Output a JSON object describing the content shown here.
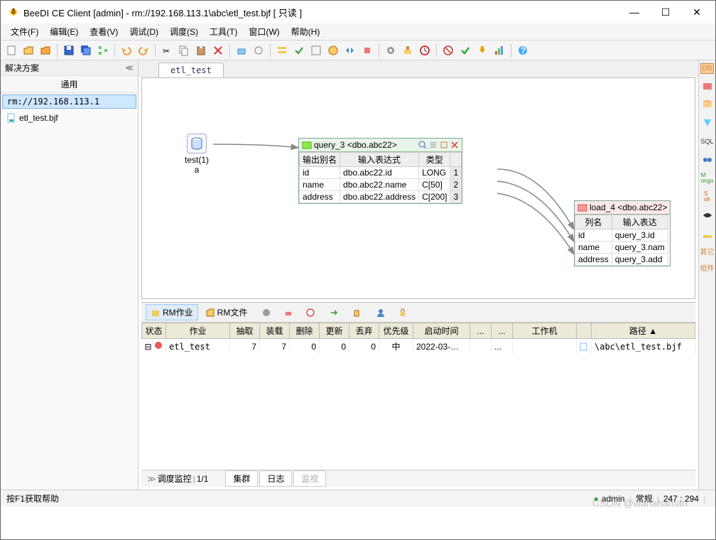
{
  "window": {
    "title": "BeeDI CE Client [admin] - rm://192.168.113.1\\abc\\etl_test.bjf [ 只读 ]"
  },
  "menu": {
    "file": "文件(F)",
    "edit": "编辑(E)",
    "view": "查看(V)",
    "debug": "调试(D)",
    "schedule": "调度(S)",
    "tools": "工具(T)",
    "window": "窗口(W)",
    "help": "帮助(H)"
  },
  "sidebar": {
    "title": "解决方案",
    "sub": "通用",
    "server": "rm://192.168.113.1",
    "file": "etl_test.bjf"
  },
  "tab": {
    "label": "etl_test"
  },
  "canvas": {
    "node1": {
      "label1": "test(1)",
      "label2": "a"
    },
    "query": {
      "title": "query_3 <dbo.abc22>",
      "cols": [
        "输出别名",
        "输入表达式",
        "类型"
      ],
      "rows": [
        [
          "id",
          "dbo.abc22.id",
          "LONG",
          "1"
        ],
        [
          "name",
          "dbo.abc22.name",
          "C[50]",
          "2"
        ],
        [
          "address",
          "dbo.abc22.address",
          "C[200]",
          "3"
        ]
      ]
    },
    "load": {
      "title": "load_4 <dbo.abc22>",
      "cols": [
        "列名",
        "输入表达"
      ],
      "rows": [
        [
          "id",
          "query_3.id"
        ],
        [
          "name",
          "query_3.nam"
        ],
        [
          "address",
          "query_3.add"
        ]
      ]
    }
  },
  "jobs": {
    "btn_rm_job": "RM作业",
    "btn_rm_file": "RM文件",
    "headers": [
      "状态",
      "作业",
      "抽取",
      "装载",
      "删除",
      "更新",
      "丢弃",
      "优先级",
      "启动时间",
      "...",
      "...",
      "工作机",
      "",
      "路径 ▲"
    ],
    "row": {
      "name": "etl_test",
      "extract": "7",
      "load": "7",
      "del": "0",
      "upd": "0",
      "discard": "0",
      "pri": "中",
      "start": "2022-03-…",
      "dots": "...",
      "path": "\\abc\\etl_test.bjf"
    },
    "tabs": {
      "sched": "调度监控",
      "page": "1/1",
      "cluster": "集群",
      "log": "日志",
      "monitor": "监视"
    }
  },
  "rightbar": {
    "db": "DB",
    "other": "其它",
    "comp": "组件"
  },
  "status": {
    "help": "按F1获取帮助",
    "user": "admin",
    "conn": "常规",
    "coord": "247 : 294"
  },
  "watermark": "CSDN @wahahaman"
}
